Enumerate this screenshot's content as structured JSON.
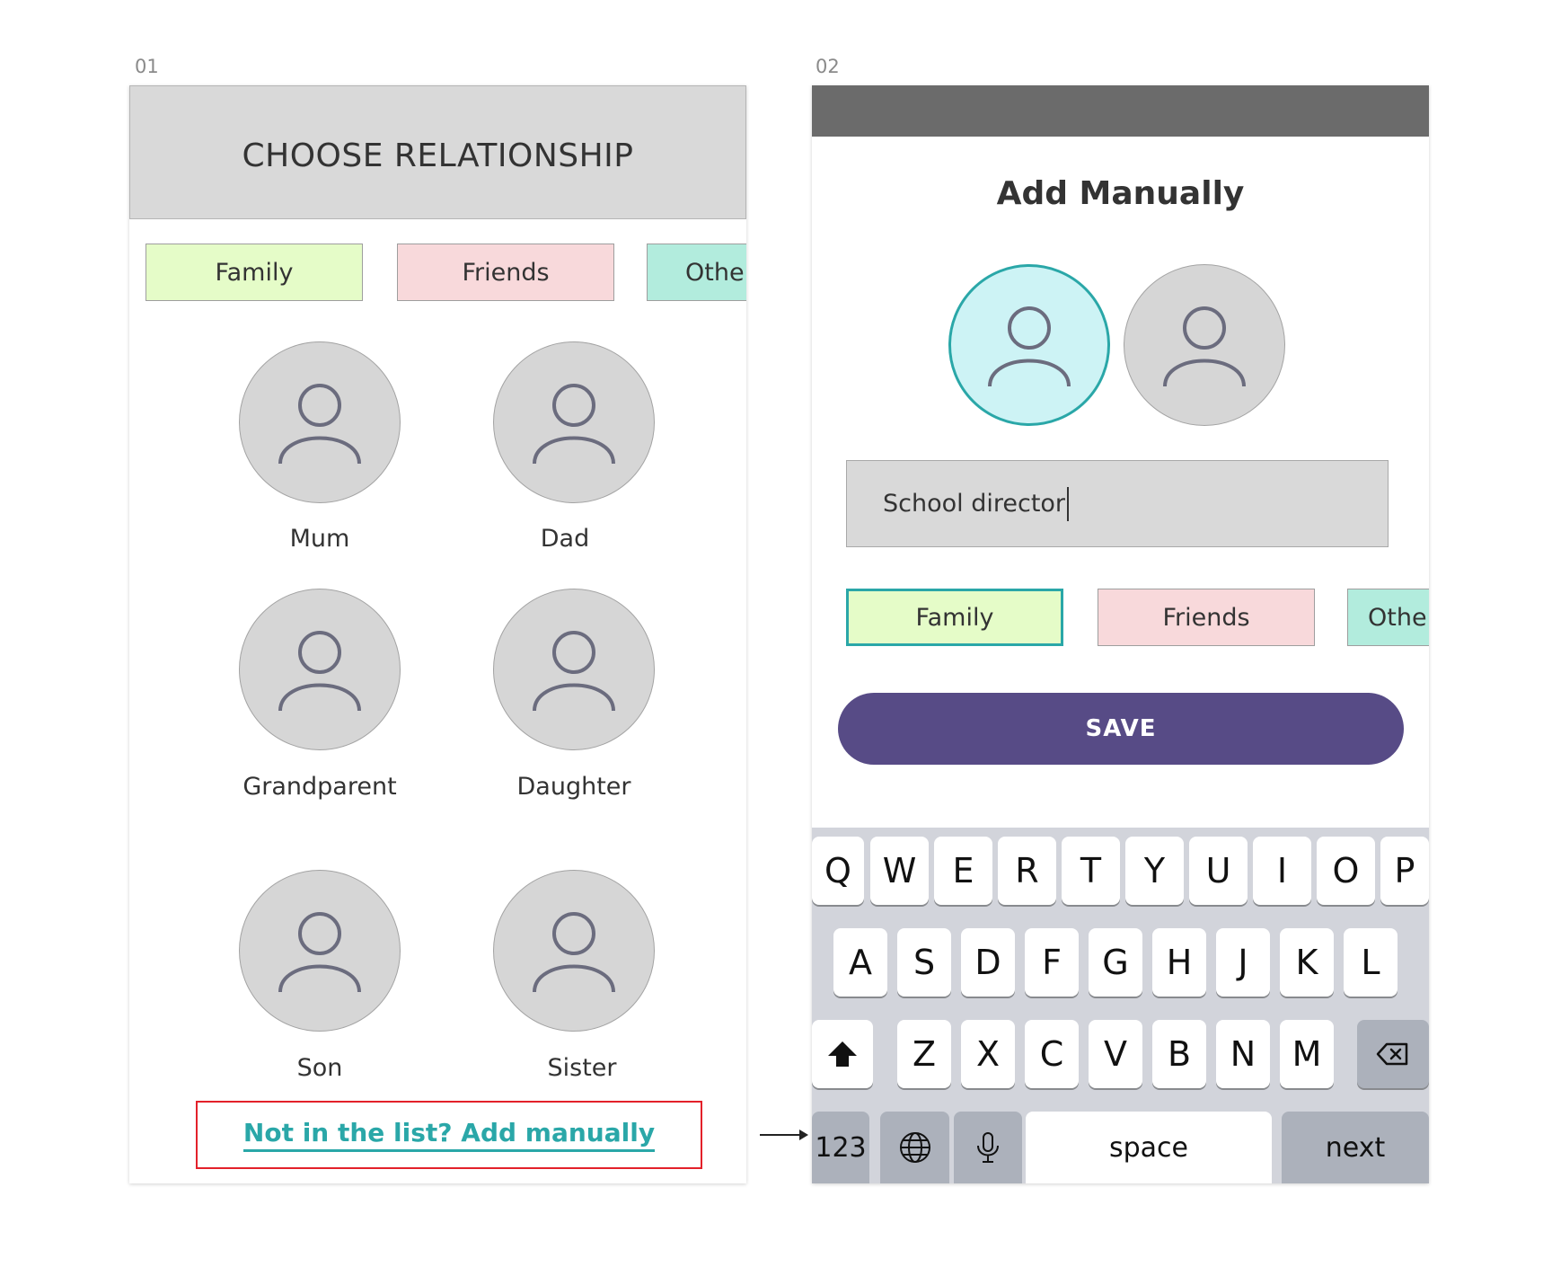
{
  "screens": {
    "s1_label": "01",
    "s2_label": "02"
  },
  "choose": {
    "title": "CHOOSE RELATIONSHIP",
    "chips": {
      "family": "Family",
      "friends": "Friends",
      "other": "Othe"
    },
    "people": {
      "mum": "Mum",
      "dad": "Dad",
      "grandparent": "Grandparent",
      "daughter": "Daughter",
      "son": "Son",
      "sister": "Sister"
    },
    "add_manually_link": "Not in the list? Add manually"
  },
  "add": {
    "title": "Add Manually",
    "name_value": "School director",
    "chips": {
      "family": "Family",
      "friends": "Friends",
      "other": "Othe"
    },
    "save_label": "SAVE"
  },
  "keyboard": {
    "row1": [
      "Q",
      "W",
      "E",
      "R",
      "T",
      "Y",
      "U",
      "I",
      "O",
      "P"
    ],
    "row2": [
      "A",
      "S",
      "D",
      "F",
      "G",
      "H",
      "J",
      "K",
      "L"
    ],
    "row3": [
      "Z",
      "X",
      "C",
      "V",
      "B",
      "N",
      "M"
    ],
    "numbers": "123",
    "space": "space",
    "next": "next"
  },
  "colors": {
    "accent_teal": "#2aa7a8",
    "save_purple": "#574b86",
    "highlight_red": "#e3212a",
    "chip_family": "#e5fcc8",
    "chip_friends": "#f8d9db",
    "chip_other": "#b2ecdd"
  },
  "icons": {
    "avatar": "person-icon",
    "shift": "shift-icon",
    "backspace": "backspace-icon",
    "globe": "globe-icon",
    "mic": "microphone-icon"
  }
}
